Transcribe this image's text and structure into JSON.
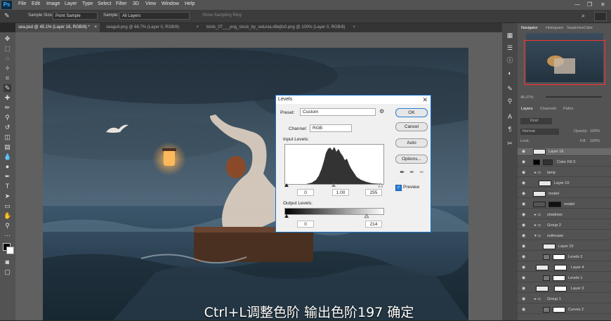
{
  "app": {
    "logo": "Ps"
  },
  "menu": [
    "File",
    "Edit",
    "Image",
    "Layer",
    "Type",
    "Select",
    "Filter",
    "3D",
    "View",
    "Window",
    "Help"
  ],
  "window_controls": {
    "minimize": "—",
    "maximize": "❐",
    "close": "✕"
  },
  "options_bar": {
    "sample_size_label": "Sample Size:",
    "sample_size_value": "Point Sample",
    "sample_label": "Sample:",
    "sample_value": "All Layers",
    "show_ring": "Show Sampling Ring"
  },
  "doc_tabs": [
    {
      "label": "sea.psd @ 45.1% (Layer 16, RGB/8) *",
      "close": "×",
      "active": true
    },
    {
      "label": "seagull.png @ 66.7% (Layer 0, RGB/8)",
      "close": "×",
      "active": false
    },
    {
      "label": "birds_07___png_stock_by_selunia-d9ejfo0.png @ 100% (Layer 0, RGB/8)",
      "close": "×",
      "active": false
    }
  ],
  "subtitle": "Ctrl+L调整色阶  输出色阶197  确定",
  "levels_dialog": {
    "title": "Levels",
    "close": "✕",
    "preset_label": "Preset:",
    "preset_value": "Custom",
    "channel_label": "Channel:",
    "channel_value": "RGB",
    "input_levels_label": "Input Levels:",
    "input_values": [
      "0",
      "1.00",
      "255"
    ],
    "output_levels_label": "Output Levels:",
    "output_values": [
      "0",
      "214"
    ],
    "buttons": {
      "ok": "OK",
      "cancel": "Cancel",
      "auto": "Auto",
      "options": "Options..."
    },
    "preview_label": "Preview",
    "preview_checked": true
  },
  "panels": {
    "nav_tabs": [
      "Navigator",
      "Histogram",
      "Swatches",
      "Color"
    ],
    "zoom_value": "45.07%",
    "layer_tabs": [
      "Layers",
      "Channels",
      "Paths"
    ],
    "kind_label": "Kind",
    "blend_mode": "Normal",
    "opacity_label": "Opacity:",
    "opacity_value": "100%",
    "lock_label": "Lock:",
    "fill_label": "Fill:",
    "fill_value": "100%"
  },
  "layers": [
    {
      "name": "Layer 16",
      "selected": true
    },
    {
      "name": "Color Fill 3",
      "selected": false
    },
    {
      "name": "lamp",
      "selected": false
    },
    {
      "name": "Layer 10",
      "selected": false
    },
    {
      "name": "model",
      "selected": false
    },
    {
      "name": "model",
      "selected": false
    },
    {
      "name": "shadows",
      "selected": false
    },
    {
      "name": "Group 2",
      "selected": false
    },
    {
      "name": "suitecase",
      "selected": false
    },
    {
      "name": "Layer 15",
      "selected": false
    },
    {
      "name": "Levels 2",
      "selected": false
    },
    {
      "name": "Layer 4",
      "selected": false
    },
    {
      "name": "Levels 1",
      "selected": false
    },
    {
      "name": "Layer 3",
      "selected": false
    },
    {
      "name": "Group 1",
      "selected": false
    },
    {
      "name": "Curves 2",
      "selected": false
    }
  ]
}
